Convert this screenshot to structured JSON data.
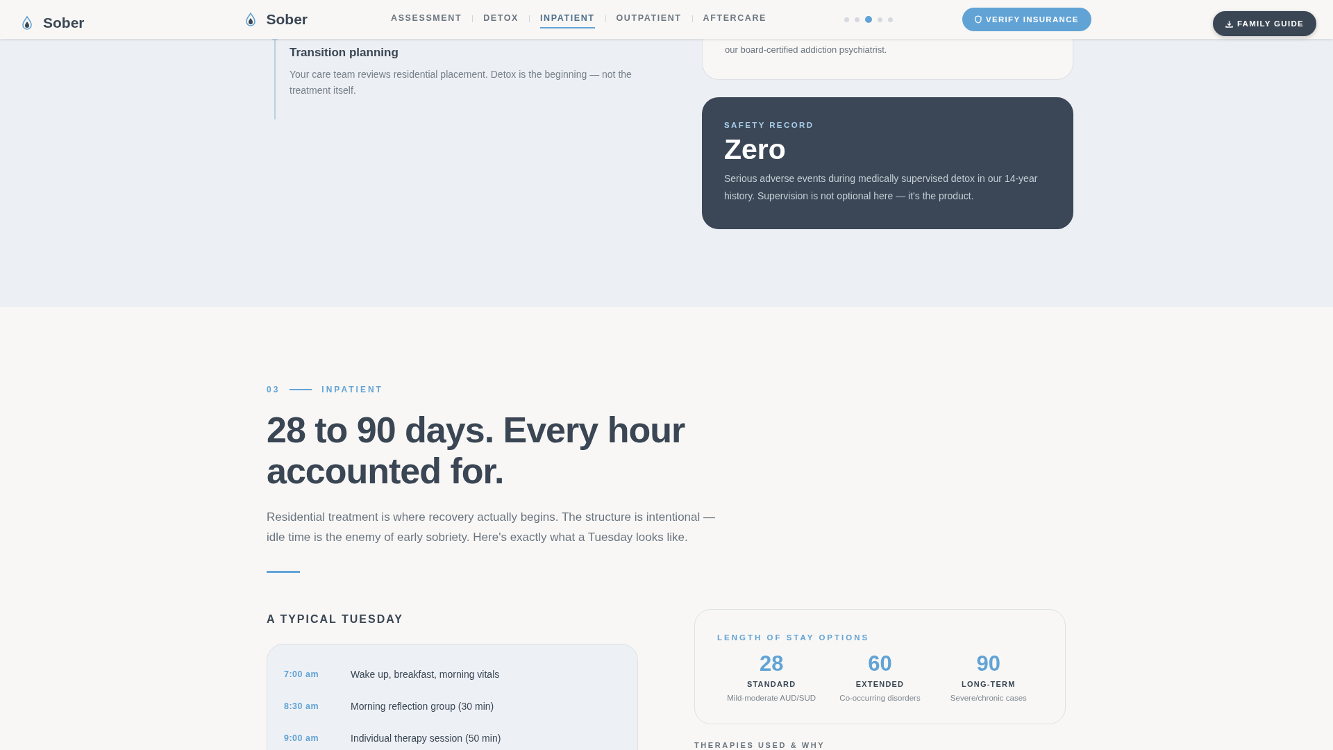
{
  "header": {
    "brand_left": "Sober",
    "brand": "Sober",
    "nav": [
      {
        "label": "ASSESSMENT",
        "selected": false
      },
      {
        "label": "DETOX",
        "selected": false
      },
      {
        "label": "INPATIENT",
        "selected": true
      },
      {
        "label": "OUTPATIENT",
        "selected": false
      },
      {
        "label": "AFTERCARE",
        "selected": false
      }
    ],
    "dots": [
      {
        "selected": false
      },
      {
        "selected": false
      },
      {
        "selected": true
      },
      {
        "selected": false
      },
      {
        "selected": false
      }
    ],
    "verify_button": "VERIFY INSURANCE",
    "guide_button": "FAMILY GUIDE"
  },
  "detox": {
    "timeline_item": {
      "title": "Transition planning",
      "text": "Your care team reviews residential placement. Detox is the beginning — not the treatment itself."
    },
    "card_text": "our board-certified addiction psychiatrist.",
    "safety": {
      "label": "SAFETY RECORD",
      "value": "Zero",
      "text": "Serious adverse events during medically supervised detox in our 14-year history. Supervision is not optional here — it's the product."
    }
  },
  "inpatient": {
    "number": "03",
    "eyebrow": "INPATIENT",
    "heading": "28 to 90 days. Every hour accounted for.",
    "intro": "Residential treatment is where recovery actually begins. The structure is intentional — idle time is the enemy of early sobriety. Here's exactly what a Tuesday looks like.",
    "schedule_title": "A TYPICAL TUESDAY",
    "schedule": [
      {
        "time": "7:00 am",
        "activity": "Wake up, breakfast, morning vitals"
      },
      {
        "time": "8:30 am",
        "activity": "Morning reflection group (30 min)"
      },
      {
        "time": "9:00 am",
        "activity": "Individual therapy session (50 min)"
      }
    ],
    "stay": {
      "title": "LENGTH OF STAY OPTIONS",
      "options": [
        {
          "days": "28",
          "label": "STANDARD",
          "note": "Mild-moderate AUD/SUD"
        },
        {
          "days": "60",
          "label": "EXTENDED",
          "note": "Co-occurring disorders"
        },
        {
          "days": "90",
          "label": "LONG-TERM",
          "note": "Severe/chronic cases"
        }
      ]
    },
    "therapies_title": "THERAPIES USED & WHY"
  }
}
